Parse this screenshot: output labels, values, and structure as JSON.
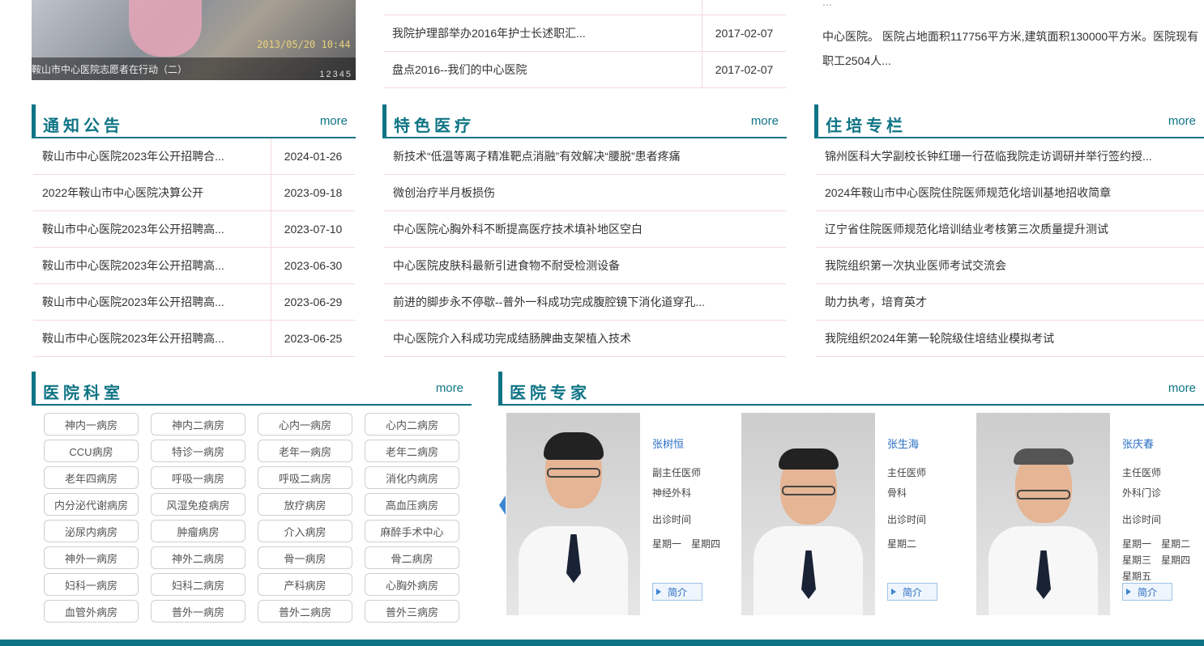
{
  "top": {
    "photo_caption": "鞍山市中心医院志愿者在行动（二）",
    "photo_stamp": "2013/05/20 10:44",
    "photo_pager": "12345",
    "news": [
      {
        "title": "我院护理部举办2016年护士长述职汇...",
        "date": "2017-02-07"
      },
      {
        "title": "盘点2016--我们的中心医院",
        "date": "2017-02-07"
      }
    ],
    "intro_line0": "...",
    "intro_line1": "中心医院。 医院占地面积117756平方米,建筑面积130000平方米。医院现有",
    "intro_line2": "职工2504人..."
  },
  "notices": {
    "title": "通知公告",
    "more": "more",
    "items": [
      {
        "title": "鞍山市中心医院2023年公开招聘合...",
        "date": "2024-01-26"
      },
      {
        "title": "2022年鞍山市中心医院决算公开",
        "date": "2023-09-18"
      },
      {
        "title": "鞍山市中心医院2023年公开招聘高...",
        "date": "2023-07-10"
      },
      {
        "title": "鞍山市中心医院2023年公开招聘高...",
        "date": "2023-06-30"
      },
      {
        "title": "鞍山市中心医院2023年公开招聘高...",
        "date": "2023-06-29"
      },
      {
        "title": "鞍山市中心医院2023年公开招聘高...",
        "date": "2023-06-25"
      }
    ]
  },
  "special": {
    "title": "特色医疗",
    "more": "more",
    "items": [
      "新技术“低温等离子精准靶点消融”有效解决“腰脱”患者疼痛",
      "微创治疗半月板损伤",
      "中心医院心胸外科不断提高医疗技术填补地区空白",
      "中心医院皮肤科最新引进食物不耐受检测设备",
      "前进的脚步永不停歇--普外一科成功完成腹腔镜下消化道穿孔...",
      "中心医院介入科成功完成结肠脾曲支架植入技术"
    ]
  },
  "training": {
    "title": "住培专栏",
    "more": "more",
    "items": [
      "锦州医科大学副校长钟红珊一行莅临我院走访调研并举行签约授...",
      "2024年鞍山市中心医院住院医师规范化培训基地招收简章",
      "辽宁省住院医师规范化培训结业考核第三次质量提升测试",
      "我院组织第一次执业医师考试交流会",
      "助力执考，培育英才",
      "我院组织2024年第一轮院级住培结业模拟考试"
    ]
  },
  "departments": {
    "title": "医院科室",
    "more": "more",
    "items": [
      "神内一病房",
      "神内二病房",
      "心内一病房",
      "心内二病房",
      "CCU病房",
      "特诊一病房",
      "老年一病房",
      "老年二病房",
      "老年四病房",
      "呼吸一病房",
      "呼吸二病房",
      "消化内病房",
      "内分泌代谢病房",
      "风湿免疫病房",
      "放疗病房",
      "高血压病房",
      "泌尿内病房",
      "肿瘤病房",
      "介入病房",
      "麻醉手术中心",
      "神外一病房",
      "神外二病房",
      "骨一病房",
      "骨二病房",
      "妇科一病房",
      "妇科二病房",
      "产科病房",
      "心胸外病房",
      "血管外病房",
      "普外一病房",
      "普外二病房",
      "普外三病房"
    ]
  },
  "experts": {
    "title": "医院专家",
    "more": "more",
    "items": [
      {
        "name": "张树恒",
        "rank": "副主任医师",
        "dept": "神经外科",
        "hours_label": "出诊时间",
        "schedule": [
          "星期一　星期四"
        ],
        "intro_btn": "简介"
      },
      {
        "name": "张生海",
        "rank": "主任医师",
        "dept": "骨科",
        "hours_label": "出诊时间",
        "schedule": [
          "星期二"
        ],
        "intro_btn": "简介"
      },
      {
        "name": "张庆春",
        "rank": "主任医师",
        "dept": "外科门诊",
        "hours_label": "出诊时间",
        "schedule": [
          "星期一　星期二",
          "星期三　星期四",
          "星期五"
        ],
        "intro_btn": "简介"
      }
    ]
  }
}
